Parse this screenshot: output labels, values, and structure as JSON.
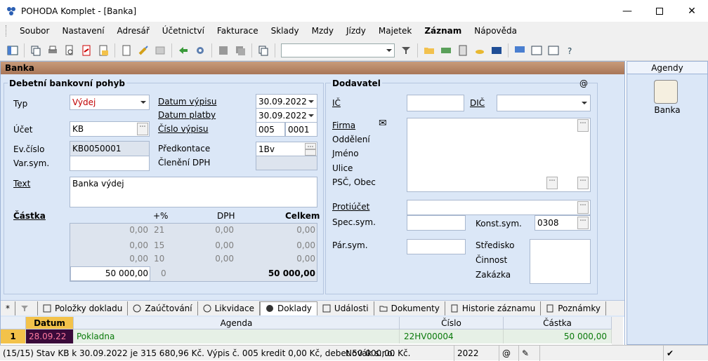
{
  "window": {
    "title": "POHODA Komplet - [Banka]"
  },
  "menu": [
    "Soubor",
    "Nastavení",
    "Adresář",
    "Účetnictví",
    "Fakturace",
    "Sklady",
    "Mzdy",
    "Jízdy",
    "Majetek",
    "Záznam",
    "Nápověda"
  ],
  "header": {
    "title": "Banka"
  },
  "left": {
    "section_title": "Debetní bankovní pohyb",
    "typ_label": "Typ",
    "typ_value": "Výdej",
    "ucet_label": "Účet",
    "ucet_value": "KB",
    "evcislo_label": "Ev.číslo",
    "evcislo_value": "KB0050001",
    "varsym_label": "Var.sym.",
    "varsym_value": "",
    "datum_vypisu_label": "Datum výpisu",
    "datum_vypisu_value": "30.09.2022",
    "datum_platby_label": "Datum platby",
    "datum_platby_value": "30.09.2022",
    "cislo_vypisu_label": "Číslo výpisu",
    "cislo_vypisu_a": "005",
    "cislo_vypisu_b": "0001",
    "predkontace_label": "Předkontace",
    "predkontace_value": "1Bv",
    "cleneni_label": "Členění DPH",
    "cleneni_value": "",
    "text_label": "Text",
    "text_value": "Banka výdej",
    "castka_label": "Částka",
    "col_pct": "+%",
    "col_dph": "DPH",
    "col_celkem": "Celkem",
    "rows": [
      {
        "base": "0,00",
        "pct": "21",
        "dph": "0,00",
        "total": "0,00"
      },
      {
        "base": "0,00",
        "pct": "15",
        "dph": "0,00",
        "total": "0,00"
      },
      {
        "base": "0,00",
        "pct": "10",
        "dph": "0,00",
        "total": "0,00"
      },
      {
        "base": "50 000,00",
        "pct": "0",
        "dph": "",
        "total": "50 000,00"
      }
    ]
  },
  "right": {
    "section_title": "Dodavatel",
    "at_symbol": "@",
    "ic_label": "IČ",
    "dic_label": "DIČ",
    "firma_label": "Firma",
    "oddeleni_label": "Oddělení",
    "jmeno_label": "Jméno",
    "ulice_label": "Ulice",
    "psc_label": "PSČ, Obec",
    "protiucet_label": "Protiúčet",
    "specsym_label": "Spec.sym.",
    "konstsym_label": "Konst.sym.",
    "konstsym_value": "0308",
    "parsym_label": "Pár.sym.",
    "stredisko_label": "Středisko",
    "cinnost_label": "Činnost",
    "zakazka_label": "Zakázka"
  },
  "agendy": {
    "title": "Agendy",
    "item": "Banka"
  },
  "tabs": [
    "Položky dokladu",
    "Zaúčtování",
    "Likvidace",
    "Doklady",
    "Události",
    "Dokumenty",
    "Historie záznamu",
    "Poznámky"
  ],
  "tabs_star": "*",
  "grid": {
    "headers": {
      "datum": "Datum",
      "agenda": "Agenda",
      "cislo": "Číslo",
      "castka": "Částka"
    },
    "row": {
      "num": "1",
      "datum": "28.09.22",
      "agenda": "Pokladna",
      "cislo": "22HV00004",
      "castka": "50 000,00"
    }
  },
  "status": {
    "main": "(15/15) Stav KB k 30.09.2022 je 315 680,96 Kč. Výpis č. 005 kredit 0,00 Kč, debet 50 000,00 Kč.",
    "company": "Novák s.r.o.",
    "year": "2022",
    "at": "@"
  }
}
